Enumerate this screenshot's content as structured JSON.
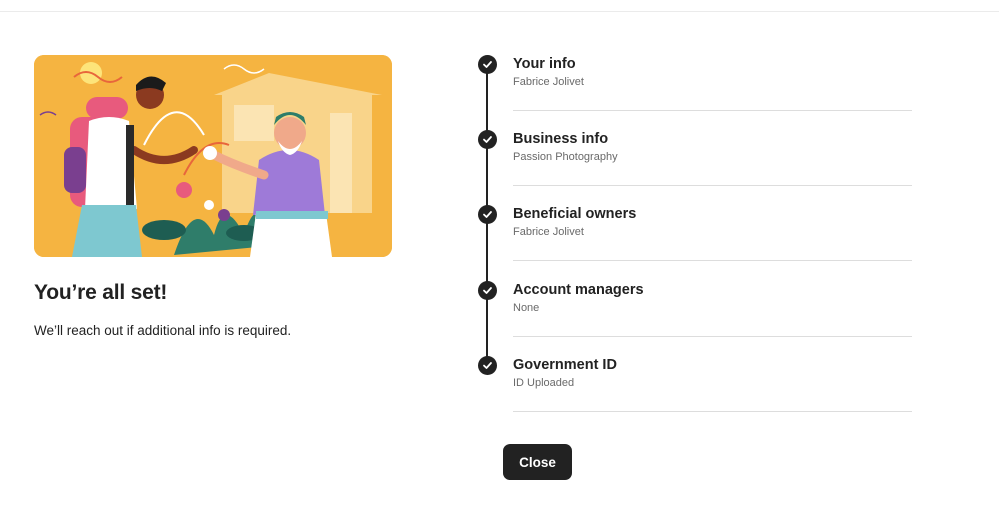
{
  "completion": {
    "headline": "You’re all set!",
    "message": "We’ll reach out if additional info is required."
  },
  "steps": [
    {
      "title": "Your info",
      "detail": "Fabrice Jolivet",
      "status": "complete"
    },
    {
      "title": "Business info",
      "detail": "Passion Photography",
      "status": "complete"
    },
    {
      "title": "Beneficial owners",
      "detail": "Fabrice Jolivet",
      "status": "complete"
    },
    {
      "title": "Account managers",
      "detail": "None",
      "status": "complete"
    },
    {
      "title": "Government ID",
      "detail": "ID Uploaded",
      "status": "complete"
    }
  ],
  "actions": {
    "close_label": "Close"
  },
  "icons": {
    "step_status": "checkmark-circle-icon"
  },
  "colors": {
    "primary": "#222222",
    "illustration_bg": "#f5b441",
    "muted_text": "#6a6a6a"
  }
}
